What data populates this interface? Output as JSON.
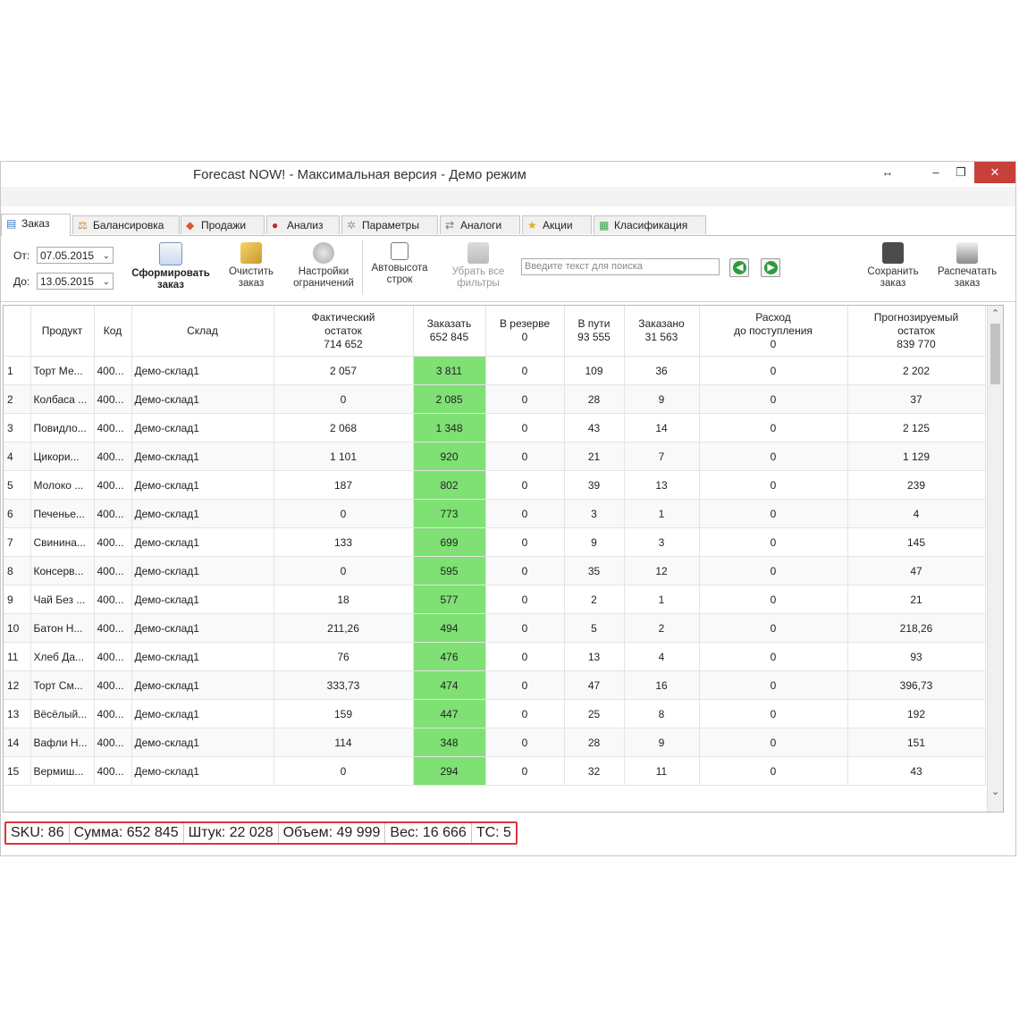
{
  "window": {
    "title": "Forecast NOW! - Максимальная версия - Демо режим",
    "controls": {
      "resize": "↔",
      "minimize": "–",
      "maximize": "❐",
      "close": "✕"
    }
  },
  "tabs": [
    {
      "label": "Заказ",
      "icon": "order-icon"
    },
    {
      "label": "Балансировка",
      "icon": "scales-icon"
    },
    {
      "label": "Продажи",
      "icon": "sales-icon"
    },
    {
      "label": "Анализ",
      "icon": "pie-icon"
    },
    {
      "label": "Параметры",
      "icon": "gear-icon"
    },
    {
      "label": "Аналоги",
      "icon": "analogs-icon"
    },
    {
      "label": "Акции",
      "icon": "star-icon"
    },
    {
      "label": "Класификация",
      "icon": "cubes-icon"
    }
  ],
  "toolbar": {
    "from_label": "От:",
    "from_value": "07.05.2015",
    "to_label": "До:",
    "to_value": "13.05.2015",
    "form_order": "Сформировать заказ",
    "clear_order": "Очистить заказ",
    "constraints": "Настройки ограничений",
    "autoheight": "Автовысота строк",
    "remove_filters": "Убрать все фильтры",
    "search_placeholder": "Введите текст для поиска",
    "prev": "◀",
    "next": "▶",
    "save_order": "Сохранить заказ",
    "print_order": "Распечатать заказ"
  },
  "columns": [
    {
      "title": "",
      "sub": "",
      "total": ""
    },
    {
      "title": "Продукт",
      "sub": "",
      "total": ""
    },
    {
      "title": "Код",
      "sub": "",
      "total": ""
    },
    {
      "title": "Склад",
      "sub": "",
      "total": ""
    },
    {
      "title": "Фактический",
      "sub": "остаток",
      "total": "714 652"
    },
    {
      "title": "Заказать",
      "sub": "",
      "total": "652 845"
    },
    {
      "title": "В резерве",
      "sub": "",
      "total": "0"
    },
    {
      "title": "В пути",
      "sub": "",
      "total": "93 555"
    },
    {
      "title": "Заказано",
      "sub": "",
      "total": "31 563"
    },
    {
      "title": "Расход",
      "sub": "до поступления",
      "total": "0"
    },
    {
      "title": "Прогнозируемый",
      "sub": "остаток",
      "total": "839 770"
    }
  ],
  "rows": [
    [
      "1",
      "Торт Ме...",
      "400...",
      "Демо-склад1",
      "2 057",
      "3 811",
      "0",
      "109",
      "36",
      "0",
      "2 202"
    ],
    [
      "2",
      "Колбаса ...",
      "400...",
      "Демо-склад1",
      "0",
      "2 085",
      "0",
      "28",
      "9",
      "0",
      "37"
    ],
    [
      "3",
      "Повидло...",
      "400...",
      "Демо-склад1",
      "2 068",
      "1 348",
      "0",
      "43",
      "14",
      "0",
      "2 125"
    ],
    [
      "4",
      "Цикори...",
      "400...",
      "Демо-склад1",
      "1 101",
      "920",
      "0",
      "21",
      "7",
      "0",
      "1 129"
    ],
    [
      "5",
      "Молоко ...",
      "400...",
      "Демо-склад1",
      "187",
      "802",
      "0",
      "39",
      "13",
      "0",
      "239"
    ],
    [
      "6",
      "Печенье...",
      "400...",
      "Демо-склад1",
      "0",
      "773",
      "0",
      "3",
      "1",
      "0",
      "4"
    ],
    [
      "7",
      "Свинина...",
      "400...",
      "Демо-склад1",
      "133",
      "699",
      "0",
      "9",
      "3",
      "0",
      "145"
    ],
    [
      "8",
      "Консерв...",
      "400...",
      "Демо-склад1",
      "0",
      "595",
      "0",
      "35",
      "12",
      "0",
      "47"
    ],
    [
      "9",
      "Чай Без ...",
      "400...",
      "Демо-склад1",
      "18",
      "577",
      "0",
      "2",
      "1",
      "0",
      "21"
    ],
    [
      "10",
      "Батон Н...",
      "400...",
      "Демо-склад1",
      "211,26",
      "494",
      "0",
      "5",
      "2",
      "0",
      "218,26"
    ],
    [
      "11",
      "Хлеб Да...",
      "400...",
      "Демо-склад1",
      "76",
      "476",
      "0",
      "13",
      "4",
      "0",
      "93"
    ],
    [
      "12",
      "Торт См...",
      "400...",
      "Демо-склад1",
      "333,73",
      "474",
      "0",
      "47",
      "16",
      "0",
      "396,73"
    ],
    [
      "13",
      "Вёсёлый...",
      "400...",
      "Демо-склад1",
      "159",
      "447",
      "0",
      "25",
      "8",
      "0",
      "192"
    ],
    [
      "14",
      "Вафли Н...",
      "400...",
      "Демо-склад1",
      "114",
      "348",
      "0",
      "28",
      "9",
      "0",
      "151"
    ],
    [
      "15",
      "Вермиш...",
      "400...",
      "Демо-склад1",
      "0",
      "294",
      "0",
      "32",
      "11",
      "0",
      "43"
    ]
  ],
  "status": [
    "SKU: 86",
    "Сумма: 652 845",
    "Штук: 22 028",
    "Объем: 49 999",
    "Вес: 16 666",
    "ТС: 5"
  ],
  "colors": {
    "highlight": "#7fe074",
    "status_border": "#d9363e",
    "close_btn": "#c7403a"
  }
}
